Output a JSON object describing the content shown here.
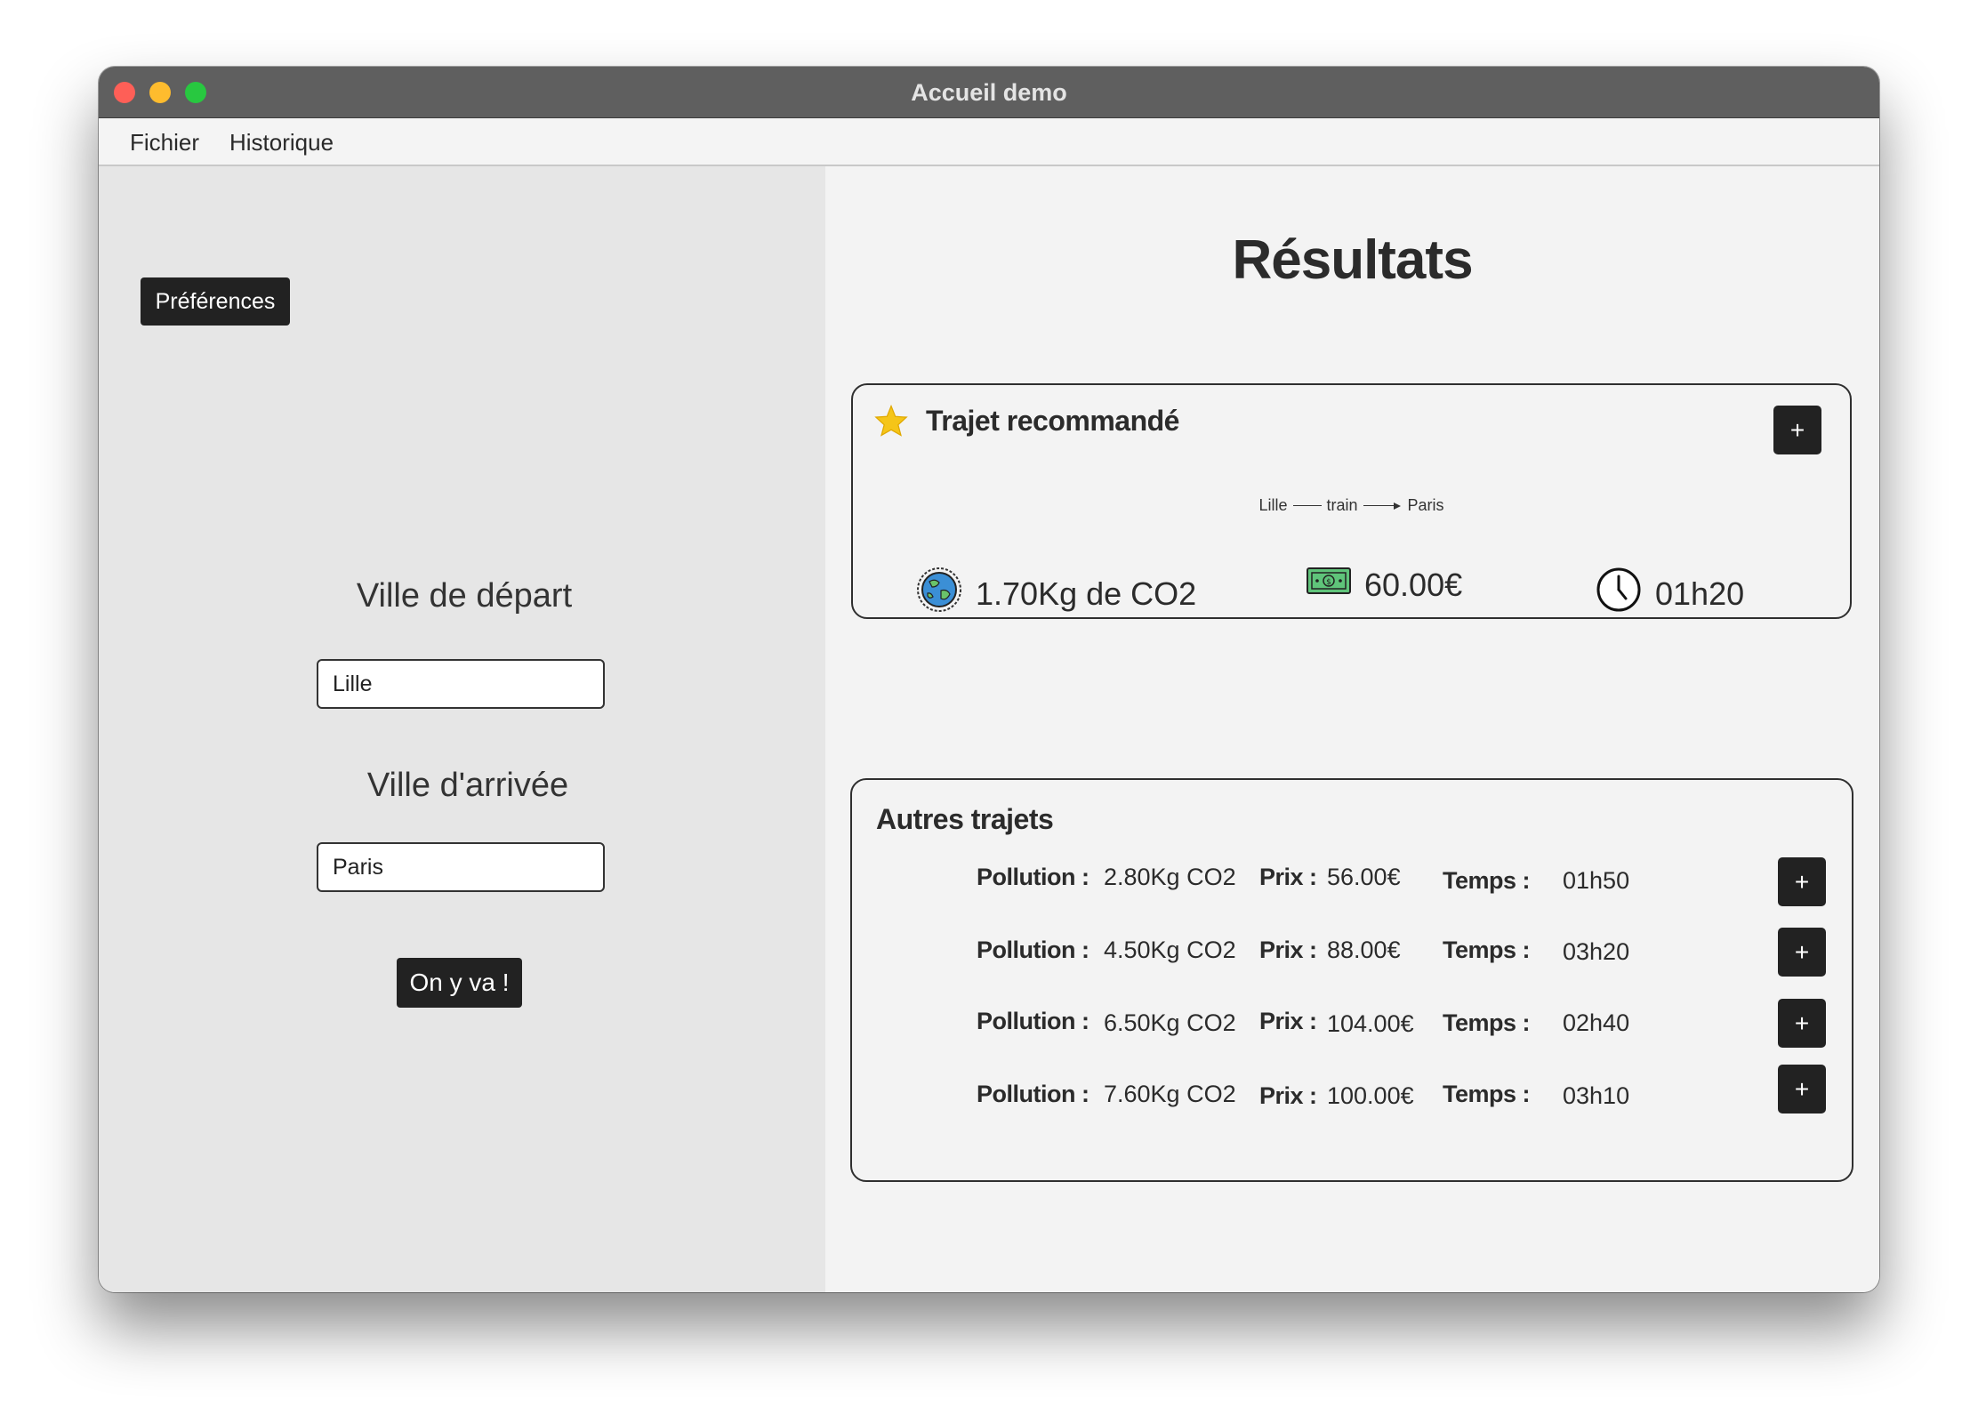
{
  "window": {
    "title": "Accueil demo"
  },
  "menu": {
    "file": "Fichier",
    "history": "Historique"
  },
  "left": {
    "preferences_label": "Préférences",
    "departure_label": "Ville de départ",
    "departure_value": "Lille",
    "arrival_label": "Ville d'arrivée",
    "arrival_value": "Paris",
    "go_label": "On y va !"
  },
  "results": {
    "title": "Résultats",
    "recommended": {
      "title": "Trajet recommandé",
      "add_label": "+",
      "route": {
        "from": "Lille",
        "mode": "train",
        "to": "Paris"
      },
      "co2": "1.70Kg de CO2",
      "price": "60.00€",
      "time": "01h20",
      "icons": {
        "title": "star-icon",
        "co2": "earth-icon",
        "price": "banknote-icon",
        "time": "clock-icon"
      }
    },
    "others": {
      "title": "Autres trajets",
      "labels": {
        "pollution": "Pollution :",
        "price": "Prix :",
        "time": "Temps :"
      },
      "rows": [
        {
          "pollution": "2.80Kg CO2",
          "price": "56.00€",
          "time": "01h50",
          "add_label": "+"
        },
        {
          "pollution": "4.50Kg CO2",
          "price": "88.00€",
          "time": "03h20",
          "add_label": "+"
        },
        {
          "pollution": "6.50Kg CO2",
          "price": "104.00€",
          "time": "02h40",
          "add_label": "+"
        },
        {
          "pollution": "7.60Kg CO2",
          "price": "100.00€",
          "time": "03h10",
          "add_label": "+"
        }
      ]
    }
  },
  "colors": {
    "titlebar": "#5f5f5f",
    "left_panel": "#e6e6e6",
    "right_panel": "#f3f3f3",
    "button_dark": "#222222",
    "close": "#fe5f57",
    "minimize": "#febc2e",
    "maximize": "#28c840",
    "star": "#f5c518",
    "banknote": "#5fc47a"
  }
}
